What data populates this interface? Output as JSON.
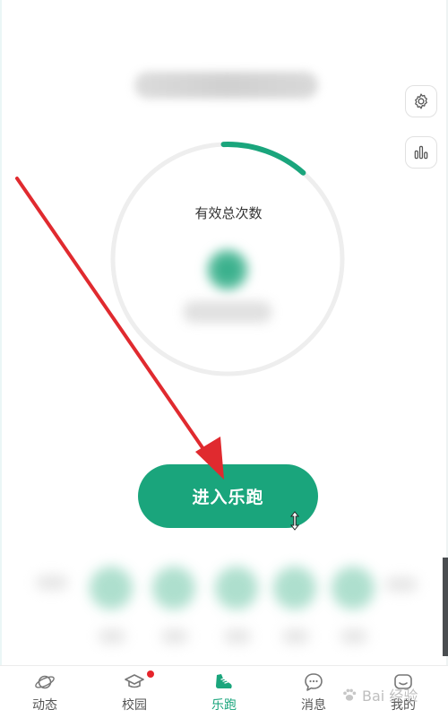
{
  "gauge": {
    "label": "有效总次数",
    "progress": 0.12,
    "track_color": "#eeeeee",
    "progress_color": "#1aa57c"
  },
  "main": {
    "enter_button_label": "进入乐跑"
  },
  "side_buttons": [
    {
      "icon": "gear-icon"
    },
    {
      "icon": "bar-chart-icon"
    }
  ],
  "tabbar": {
    "items": [
      {
        "label": "动态",
        "icon": "planet-icon",
        "active": false
      },
      {
        "label": "校园",
        "icon": "graduation-cap-icon",
        "active": false,
        "badge": true
      },
      {
        "label": "乐跑",
        "icon": "running-shoe-icon",
        "active": true
      },
      {
        "label": "消息",
        "icon": "chat-bubble-icon",
        "active": false
      },
      {
        "label": "我的",
        "icon": "profile-icon",
        "active": false
      }
    ]
  },
  "watermark": {
    "text": "Bai  经验"
  },
  "colors": {
    "accent": "#1aa57c",
    "badge": "#e6242b",
    "arrow": "#e02a2f"
  }
}
